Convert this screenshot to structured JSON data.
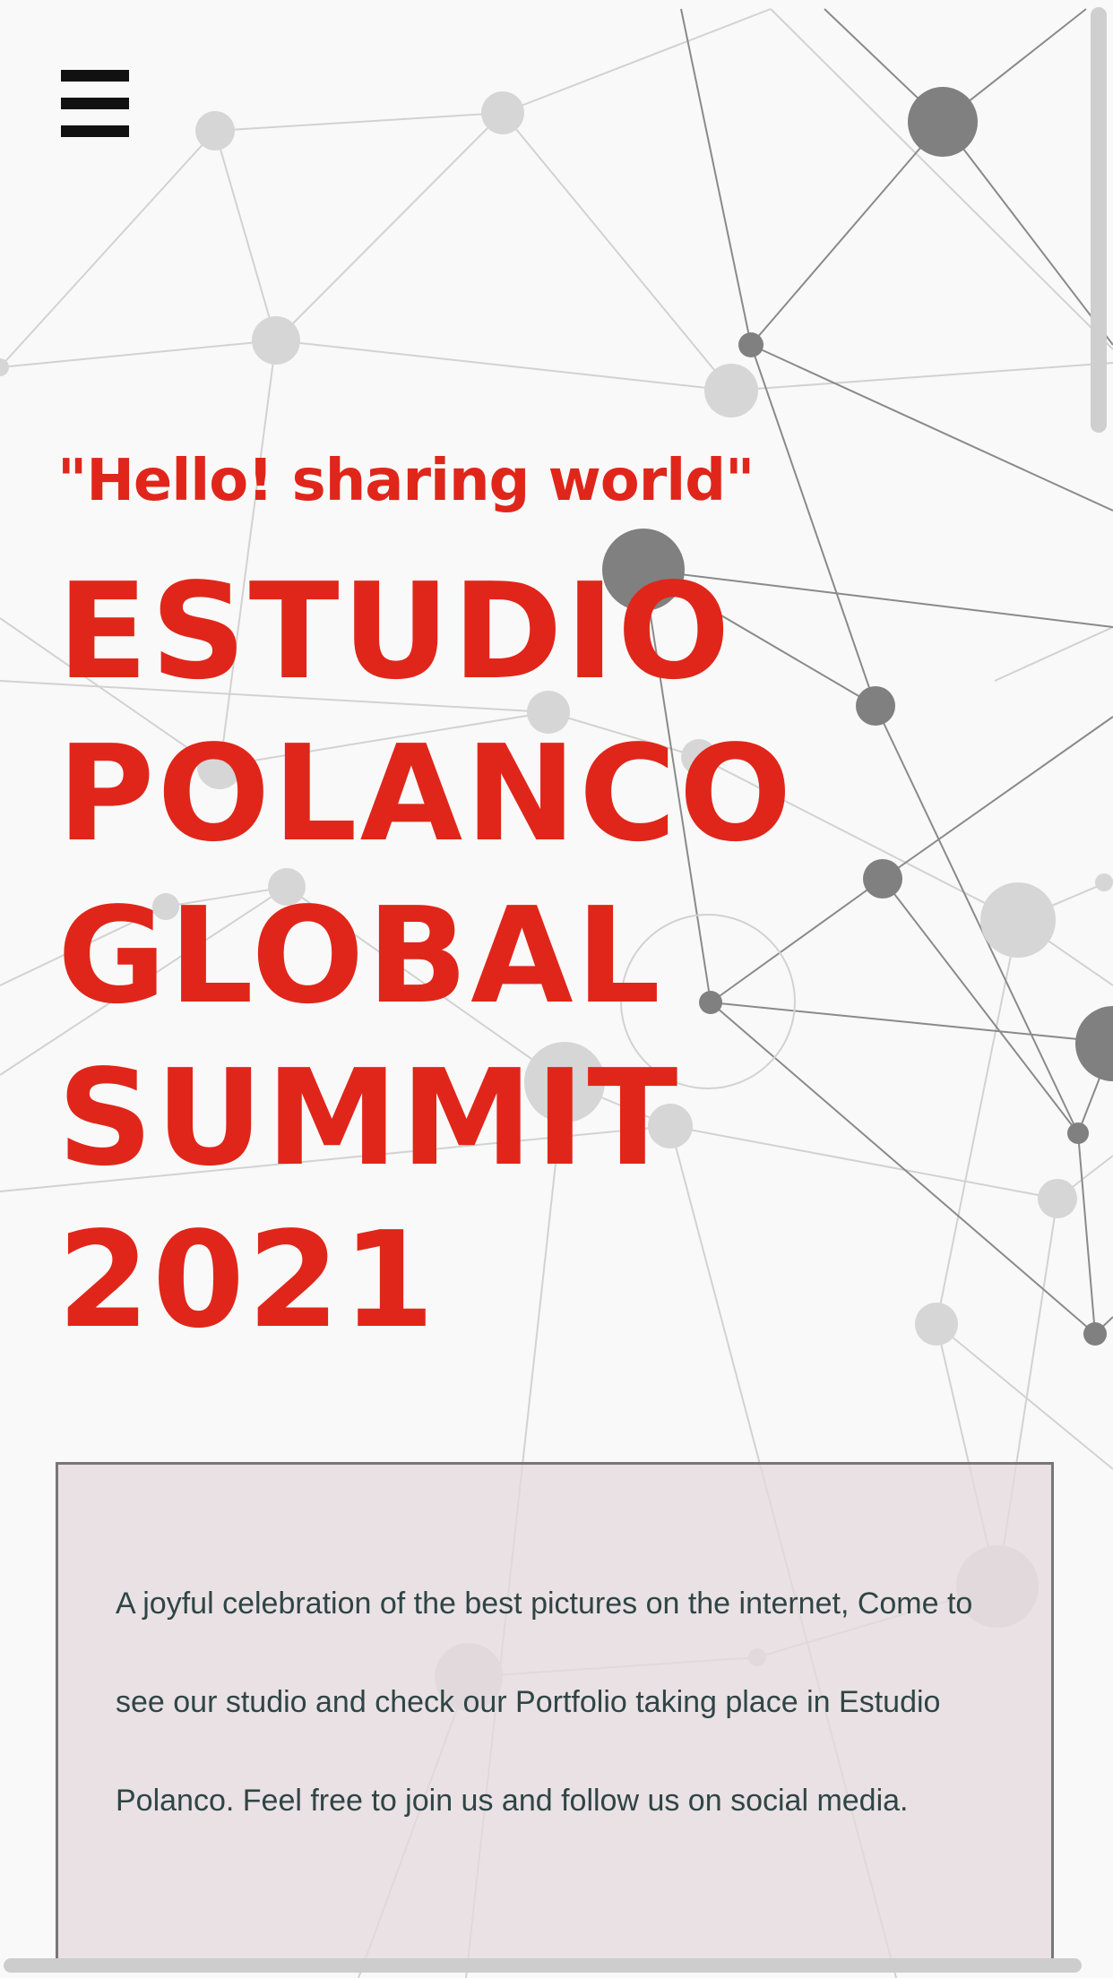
{
  "nav": {
    "menu_icon": "hamburger-menu-icon"
  },
  "hero": {
    "tagline": "\"Hello! sharing world\"",
    "headline_lines": [
      "ESTUDIO",
      "POLANCO",
      "GLOBAL",
      "SUMMIT",
      "2021"
    ]
  },
  "intro": {
    "text": "A joyful celebration of the best pictures on the internet, Come to see our studio and check our Portfolio taking place in Estudio Polanco. Feel free to join us and follow us on social media."
  },
  "colors": {
    "accent": "#e0261a",
    "body_text": "#2f4545",
    "box_background": "#e8dfe1",
    "box_border": "#777777",
    "page_background": "#f9f9f9"
  }
}
